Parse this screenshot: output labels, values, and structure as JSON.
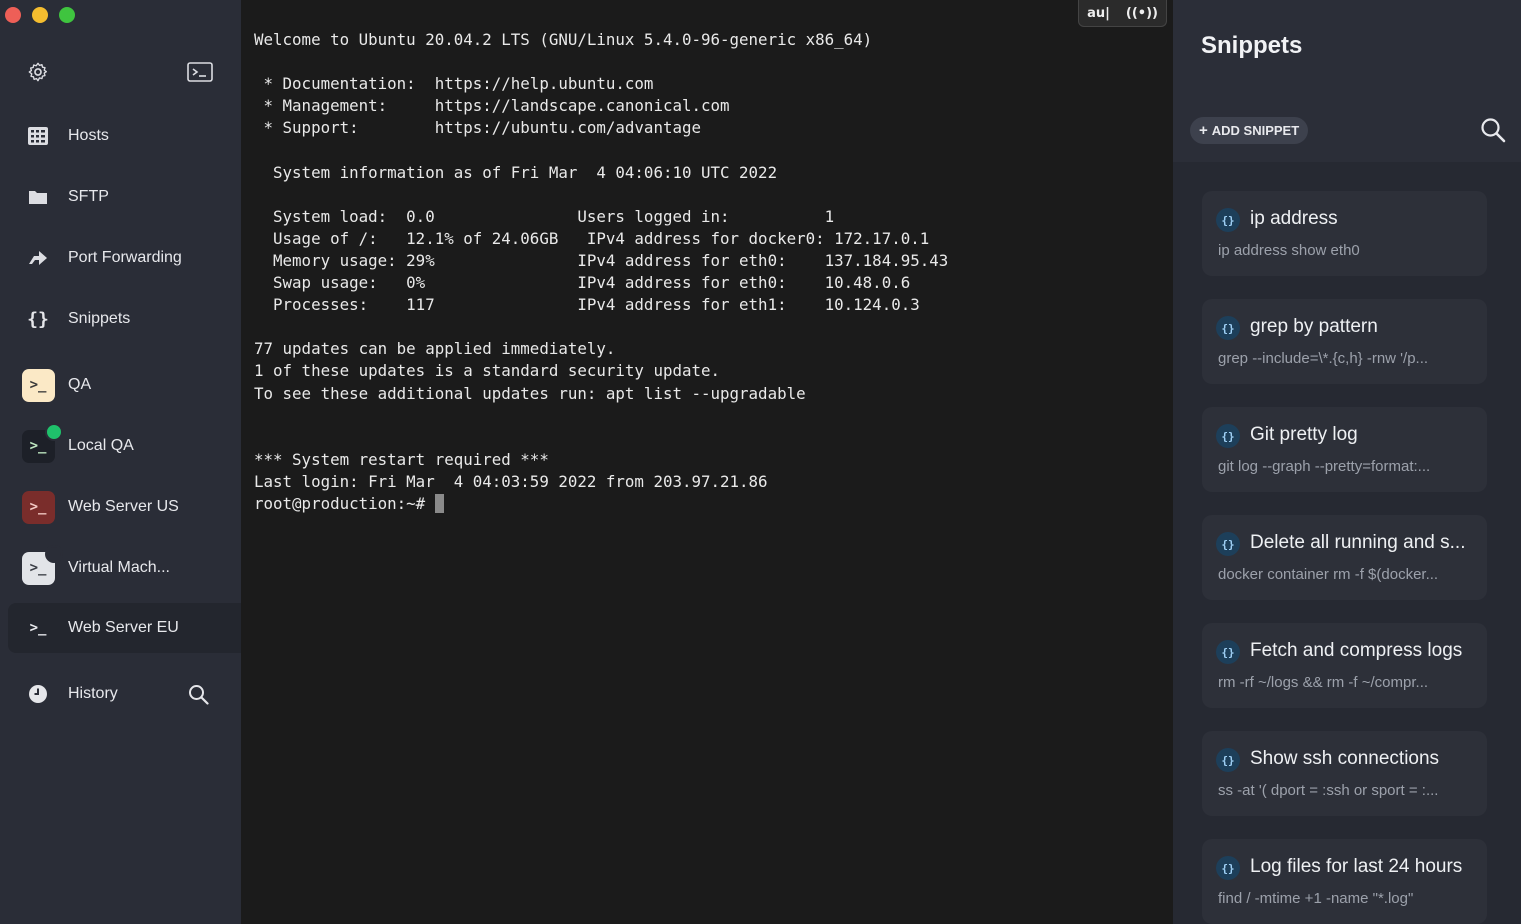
{
  "sidebar": {
    "items": [
      {
        "label": "Hosts",
        "icon": "hosts-icon"
      },
      {
        "label": "SFTP",
        "icon": "folder-icon"
      },
      {
        "label": "Port Forwarding",
        "icon": "port-forwarding-icon"
      },
      {
        "label": "Snippets",
        "icon": "braces-icon"
      }
    ],
    "hosts": [
      {
        "label": "QA",
        "icon_bg": "#fbe9c6",
        "icon_fg": "#3a3a3a",
        "status": null
      },
      {
        "label": "Local QA",
        "icon_bg": "#1d2028",
        "icon_fg": "#bfe7c0",
        "status": "#1fc16b"
      },
      {
        "label": "Web Server US",
        "icon_bg": "#7a2d2b",
        "icon_fg": "#f3c9c4",
        "status": null
      },
      {
        "label": "Virtual Mach...",
        "icon_bg": "#e2e4e8",
        "icon_fg": "#3a3d45",
        "status": "#2a2d37"
      },
      {
        "label": "Web Server EU",
        "icon_bg": "transparent",
        "icon_fg": "#e9eaee",
        "status": null
      }
    ],
    "history_label": "History",
    "host_icon_glyph": ">_"
  },
  "terminal": {
    "badges": {
      "keyboard": "au|",
      "broadcast": "((•))"
    },
    "lines": "Welcome to Ubuntu 20.04.2 LTS (GNU/Linux 5.4.0-96-generic x86_64)\n\n * Documentation:  https://help.ubuntu.com\n * Management:     https://landscape.canonical.com\n * Support:        https://ubuntu.com/advantage\n\n  System information as of Fri Mar  4 04:06:10 UTC 2022\n\n  System load:  0.0               Users logged in:          1\n  Usage of /:   12.1% of 24.06GB   IPv4 address for docker0: 172.17.0.1\n  Memory usage: 29%               IPv4 address for eth0:    137.184.95.43\n  Swap usage:   0%                IPv4 address for eth0:    10.48.0.6\n  Processes:    117               IPv4 address for eth1:    10.124.0.3\n\n77 updates can be applied immediately.\n1 of these updates is a standard security update.\nTo see these additional updates run: apt list --upgradable\n\n\n*** System restart required ***\nLast login: Fri Mar  4 04:03:59 2022 from 203.97.21.86\n",
    "prompt": "root@production:~# "
  },
  "snippets": {
    "title": "Snippets",
    "add_label": "ADD SNIPPET",
    "badge_glyph": "{}",
    "items": [
      {
        "name": "ip address",
        "cmd": "ip address show eth0"
      },
      {
        "name": "grep by pattern",
        "cmd": "grep --include=\\*.{c,h} -rnw '/p..."
      },
      {
        "name": "Git pretty log",
        "cmd": "git log --graph --pretty=format:..."
      },
      {
        "name": "Delete all running and s...",
        "cmd": "docker container rm -f $(docker..."
      },
      {
        "name": "Fetch and compress logs",
        "cmd": "rm -rf ~/logs && rm -f ~/compr..."
      },
      {
        "name": "Show ssh connections",
        "cmd": "ss -at '( dport = :ssh or sport = :..."
      },
      {
        "name": "Log files for last 24 hours",
        "cmd": "find / -mtime +1 -name \"*.log\""
      }
    ]
  }
}
